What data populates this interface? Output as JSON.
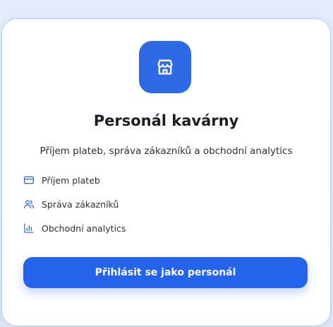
{
  "card": {
    "logo_icon": "store-icon",
    "title": "Personál kavárny",
    "subtitle": "Příjem plateb, správa zákazníků a obchodní analytics"
  },
  "features": [
    {
      "icon": "credit-card-icon",
      "label": "Příjem plateb"
    },
    {
      "icon": "users-icon",
      "label": "Správa zákazníků"
    },
    {
      "icon": "bar-chart-icon",
      "label": "Obchodní analytics"
    }
  ],
  "cta": {
    "label": "Přihlásit se jako personál"
  },
  "colors": {
    "accent": "#2563eb",
    "logo_bg": "#2f6ae6",
    "icon": "#3b6fd8"
  }
}
